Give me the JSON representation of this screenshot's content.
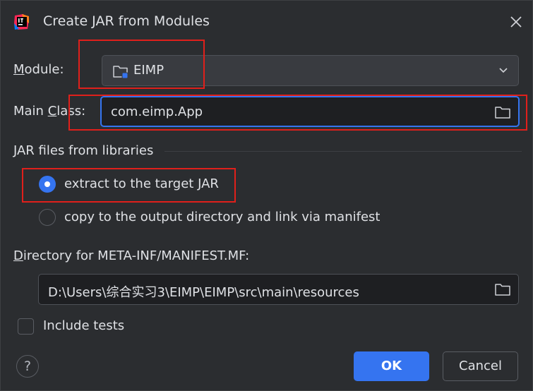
{
  "window": {
    "title": "Create JAR from Modules"
  },
  "module": {
    "label_pre": "",
    "label_mnemonic": "M",
    "label_post": "odule:",
    "value": "EIMP"
  },
  "main_class": {
    "label_pre": "Main ",
    "label_mnemonic": "C",
    "label_post": "lass:",
    "value": "com.eimp.App"
  },
  "jar_files": {
    "section_title": "JAR files from libraries",
    "options": [
      {
        "label": "extract to the target JAR",
        "selected": true
      },
      {
        "label": "copy to the output directory and link via manifest",
        "selected": false
      }
    ]
  },
  "manifest": {
    "label_mnemonic": "D",
    "label_post": "irectory for META-INF/MANIFEST.MF:",
    "value": "D:\\Users\\综合实习3\\EIMP\\EIMP\\src\\main\\resources"
  },
  "include_tests": {
    "label": "Include tests",
    "checked": false
  },
  "footer": {
    "help_glyph": "?",
    "ok_label": "OK",
    "cancel_label": "Cancel"
  },
  "colors": {
    "background": "#2b2d30",
    "accent": "#3574f0",
    "highlight": "#e0201b"
  },
  "icons": {
    "app": "intellij-idea-icon",
    "close": "close-icon",
    "module": "module-folder-icon",
    "dropdown": "chevron-down-icon",
    "browse": "folder-icon"
  }
}
